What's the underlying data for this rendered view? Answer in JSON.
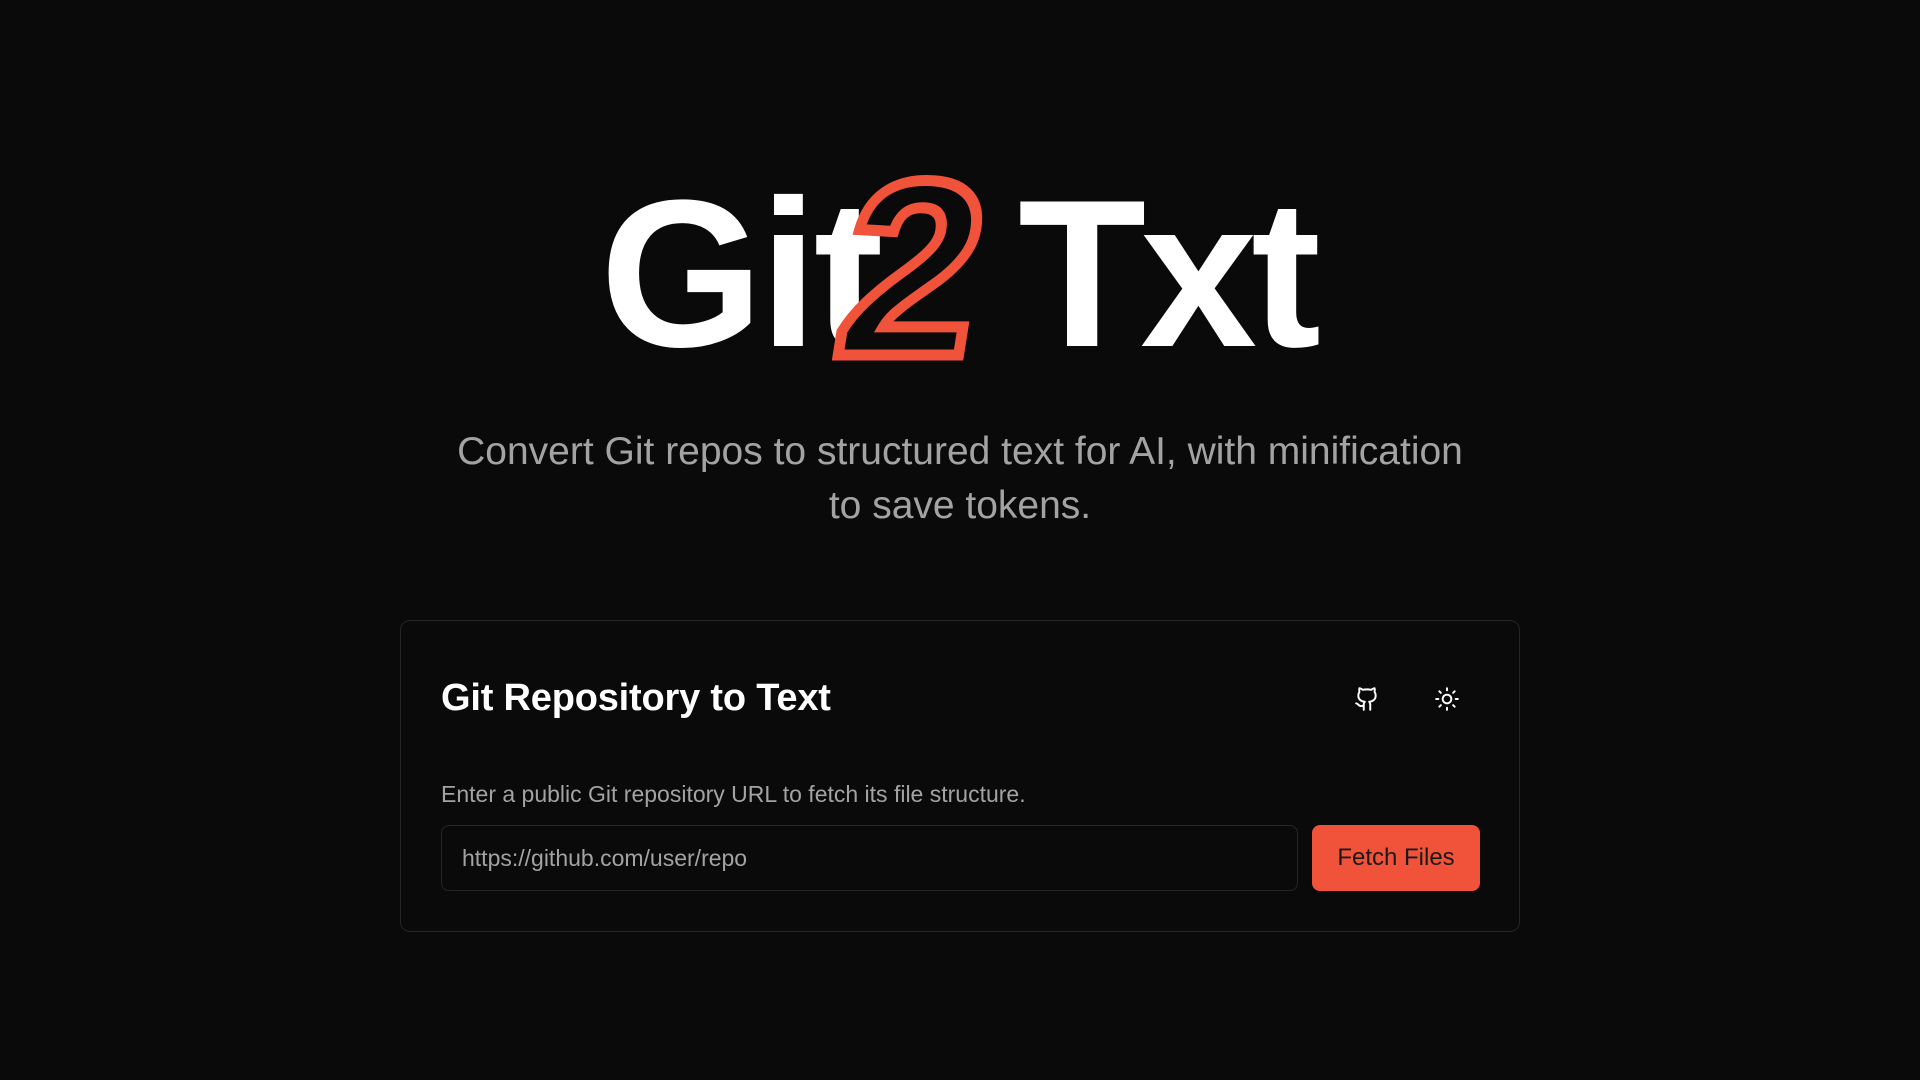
{
  "logo": {
    "part1": "Git",
    "part2": "2",
    "part3": "Txt",
    "accent_color": "#f0533a"
  },
  "tagline": {
    "line1": "Convert Git repos to structured text for AI, with minification",
    "line2": "to save tokens."
  },
  "card": {
    "title": "Git Repository to Text",
    "description": "Enter a public Git repository URL to fetch its file structure.",
    "icons": {
      "github": "github-icon",
      "theme": "sun-icon"
    },
    "input": {
      "value": "",
      "placeholder": "https://github.com/user/repo"
    },
    "fetch_label": "Fetch Files"
  },
  "colors": {
    "background": "#0a0a0a",
    "accent": "#f0533a",
    "muted_text": "#a3a3a3",
    "border": "#262626"
  }
}
